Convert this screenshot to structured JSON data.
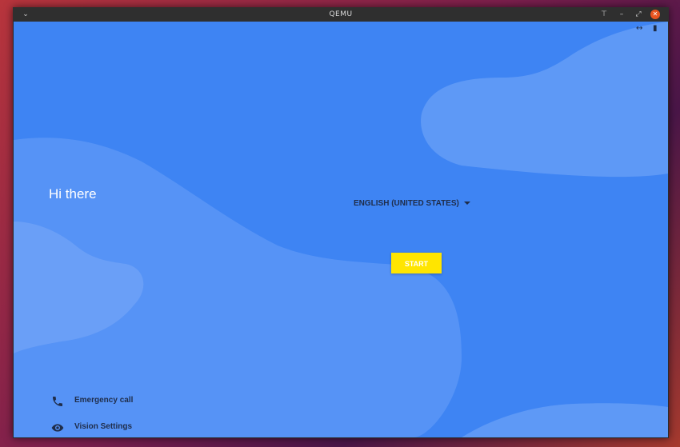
{
  "window": {
    "title": "QEMU",
    "menu_icon": "chevron-down-icon",
    "pin_icon": "pin-icon",
    "minimize_icon": "minimize-icon",
    "maximize_icon": "maximize-icon",
    "close_icon": "close-icon",
    "close_color": "#e95420"
  },
  "status_bar": {
    "data_icon": "data-arrows-icon",
    "battery_icon": "battery-icon"
  },
  "welcome": {
    "greeting": "Hi there",
    "language": "ENGLISH (UNITED STATES)",
    "start_label": "START",
    "start_color": "#ffe500",
    "background_color": "#3e84f3"
  },
  "bottom": {
    "emergency_label": "Emergency call",
    "emergency_icon": "phone-icon",
    "vision_label": "Vision Settings",
    "vision_icon": "eye-icon"
  }
}
